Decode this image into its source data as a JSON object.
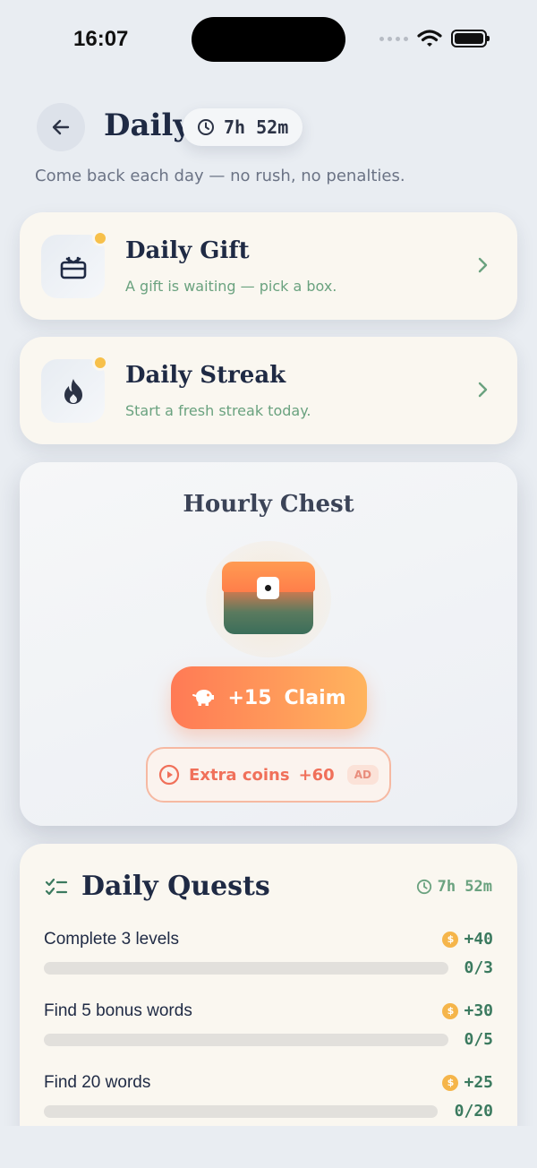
{
  "status_bar": {
    "time": "16:07"
  },
  "header": {
    "title": "Daily",
    "timer": "7h 52m",
    "subtitle": "Come back each day — no rush, no penalties."
  },
  "rows": [
    {
      "title": "Daily Gift",
      "subtitle": "A gift is waiting — pick a box."
    },
    {
      "title": "Daily Streak",
      "subtitle": "Start a fresh streak today."
    }
  ],
  "chest": {
    "title": "Hourly Chest",
    "claim_amount": "+15",
    "claim_label": "Claim",
    "extra_label": "Extra coins",
    "extra_amount": "+60",
    "ad_badge": "AD"
  },
  "quests": {
    "title": "Daily Quests",
    "timer": "7h 52m",
    "coin_symbol": "$",
    "items": [
      {
        "label": "Complete 3 levels",
        "reward": "+40",
        "progress": "0/3",
        "fraction": 0
      },
      {
        "label": "Find 5 bonus words",
        "reward": "+30",
        "progress": "0/5",
        "fraction": 0
      },
      {
        "label": "Find 20 words",
        "reward": "+25",
        "progress": "0/20",
        "fraction": 0
      }
    ]
  },
  "colors": {
    "accent_green": "#6aa27f",
    "accent_orange": "#ff7a55",
    "badge_yellow": "#f7c04a"
  }
}
